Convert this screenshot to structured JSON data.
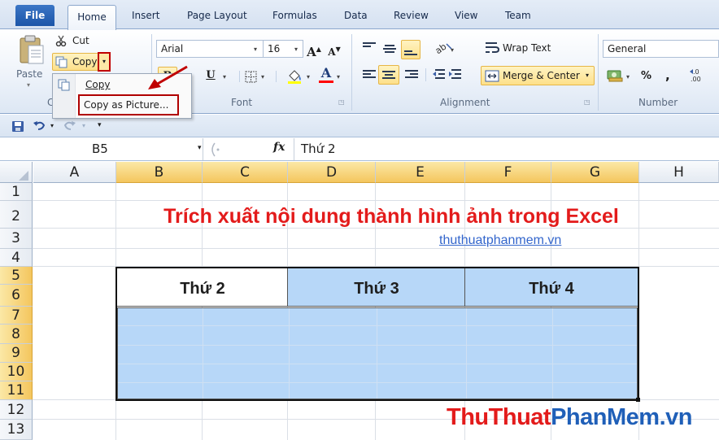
{
  "tabs": {
    "file": "File",
    "home": "Home",
    "insert": "Insert",
    "page_layout": "Page Layout",
    "formulas": "Formulas",
    "data": "Data",
    "review": "Review",
    "view": "View",
    "team": "Team"
  },
  "clipboard": {
    "cut": "Cut",
    "copy": "Copy",
    "paste": "Paste",
    "group_short": "C"
  },
  "copy_menu": {
    "copy": "Copy",
    "copy_as_picture": "Copy as Picture..."
  },
  "font": {
    "name": "Arial",
    "size": "16",
    "group_label": "Font",
    "bold": "B",
    "underline": "U",
    "grow": "A",
    "shrink": "A",
    "color_letter": "A",
    "color_accent": "#ff0000"
  },
  "alignment": {
    "wrap_text": "Wrap Text",
    "merge_center": "Merge & Center",
    "group_label": "Alignment"
  },
  "number": {
    "format": "General",
    "group_label": "Number",
    "percent": "%",
    "comma": ","
  },
  "formula_bar": {
    "name_box": "B5",
    "fx": "fx",
    "content": "Thứ 2"
  },
  "sheet": {
    "columns": [
      "A",
      "B",
      "C",
      "D",
      "E",
      "F",
      "G",
      "H"
    ],
    "rows": [
      "1",
      "2",
      "3",
      "4",
      "5",
      "6",
      "7",
      "8",
      "9",
      "10",
      "11",
      "12",
      "13"
    ],
    "title": "Trích xuất nội dung thành hình ảnh trong Excel",
    "title_color": "#e31b1b",
    "link": "thuthuatphanmem.vn",
    "headers": [
      "Thứ 2",
      "Thứ 3",
      "Thứ 4"
    ],
    "fill_color": "#b7d7f8"
  },
  "watermark": {
    "part1": "ThuThuat",
    "part2": "PhanMem",
    "part3": ".vn",
    "color_red": "#e31b1b",
    "color_blue": "#1f5fb8"
  }
}
